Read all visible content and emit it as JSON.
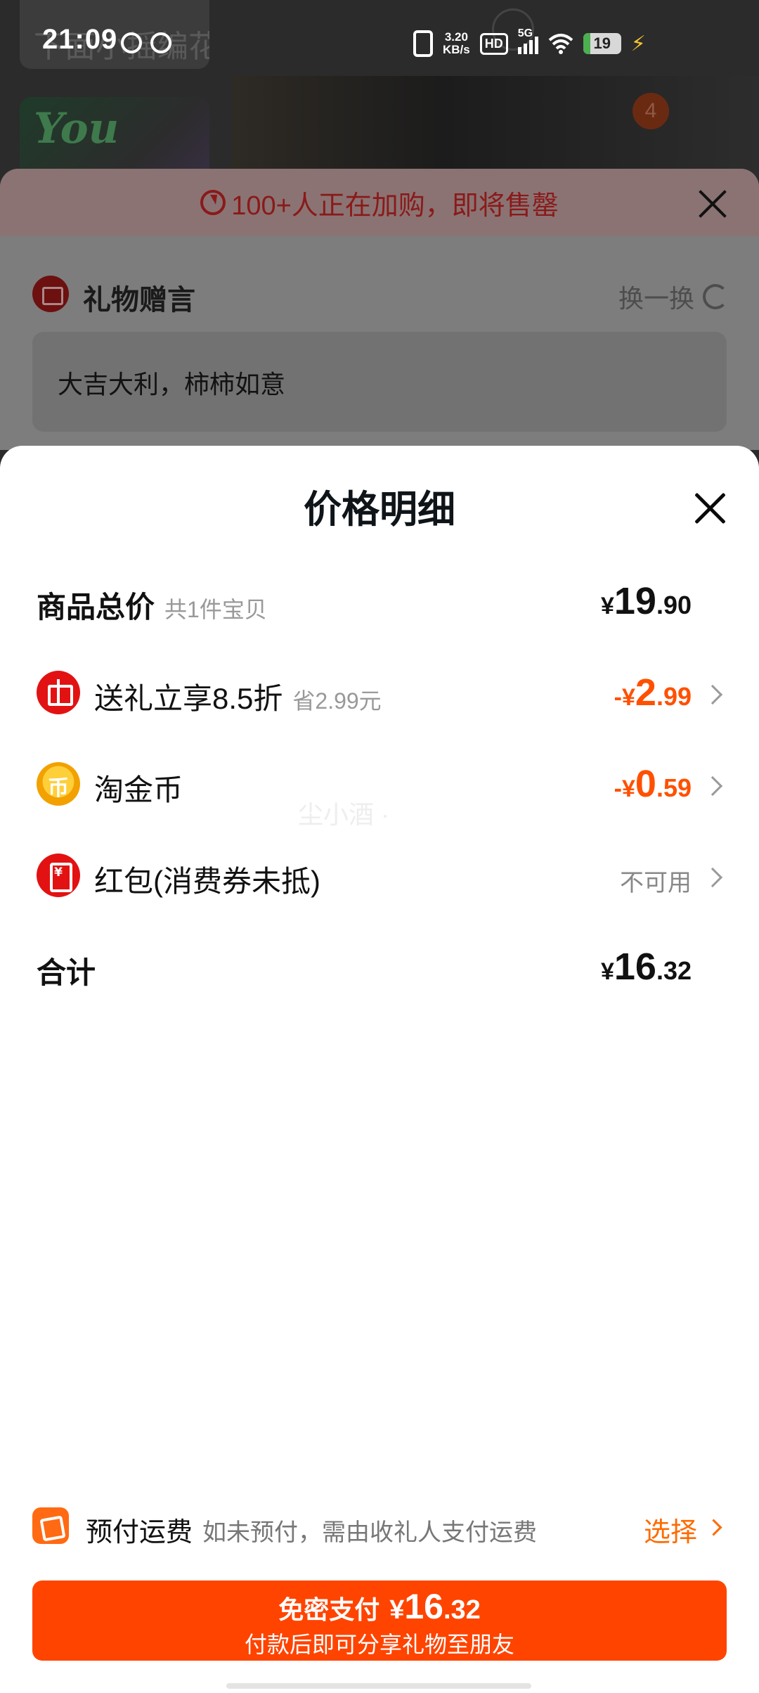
{
  "status_bar": {
    "time": "21:09",
    "net_speed": "3.20",
    "net_unit": "KB/s",
    "hd": "HD",
    "signal_type": "5G",
    "battery": "19"
  },
  "background": {
    "thumb_text": "下面小摇编花",
    "badge_count": "4"
  },
  "gift_sheet": {
    "urgency_text": "100+人正在加购，即将售罄",
    "title": "礼物赠言",
    "swap_label": "换一换",
    "message": "大吉大利，柿柿如意"
  },
  "price_sheet": {
    "title": "价格明细",
    "rows": {
      "total": {
        "label": "商品总价",
        "sub": "共1件宝贝",
        "cur": "¥",
        "int": "19",
        "dec": ".90"
      },
      "gift_discount": {
        "label": "送礼立享8.5折",
        "sub": "省2.99元",
        "cur": "-¥",
        "int": "2",
        "dec": ".99"
      },
      "gold_coin": {
        "label": "淘金币",
        "cur": "-¥",
        "int": "0",
        "dec": ".59"
      },
      "red_packet": {
        "label": "红包(消费券未抵)",
        "value": "不可用"
      },
      "sum": {
        "label": "合计",
        "cur": "¥",
        "int": "16",
        "dec": ".32"
      }
    },
    "watermark": "尘小酒 ·"
  },
  "shipping": {
    "title": "预付运费",
    "note": "如未预付，需由收礼人支付运费",
    "action": "选择"
  },
  "pay_button": {
    "label": "免密支付",
    "cur": "¥",
    "int": "16",
    "dec": ".32",
    "subtitle": "付款后即可分享礼物至朋友"
  },
  "colors": {
    "accent": "#ff5000",
    "pay_button": "#ff4400",
    "gift_icon": "#e31212"
  },
  "icons": [
    "vibrate-icon",
    "wifi-icon",
    "battery-icon",
    "bolt-icon",
    "close-icon",
    "gift-icon",
    "refresh-icon",
    "coin-icon",
    "red-packet-icon",
    "chevron-right-icon",
    "shipping-box-icon"
  ]
}
